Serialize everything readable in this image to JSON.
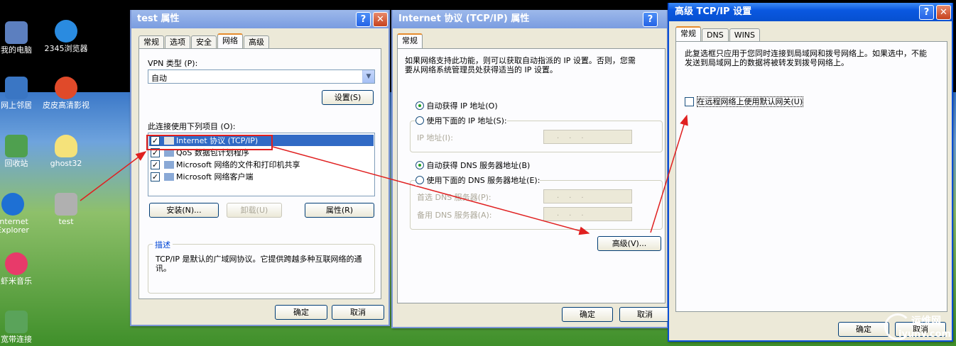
{
  "desktop": {
    "icons": [
      {
        "label": "我的电脑",
        "name": "my-computer-icon",
        "color": "#5c7fbf"
      },
      {
        "label": "2345浏览器",
        "name": "browser-2345-icon",
        "color": "#2a8be0"
      },
      {
        "label": "网上邻居",
        "name": "network-places-icon",
        "color": "#3a76c4"
      },
      {
        "label": "皮皮高清影视",
        "name": "pipi-video-icon",
        "color": "#e04a2a"
      },
      {
        "label": "回收站",
        "name": "recycle-bin-icon",
        "color": "#4fa04f"
      },
      {
        "label": "ghost32",
        "name": "ghost32-icon",
        "color": "#f5e27a"
      },
      {
        "label": "Internet Explorer",
        "name": "internet-explorer-icon",
        "color": "#1e70d4"
      },
      {
        "label": "test",
        "name": "test-connection-icon",
        "color": "#b0b0b0"
      },
      {
        "label": "虾米音乐",
        "name": "xiami-music-icon",
        "color": "#e83a6a"
      },
      {
        "label": "宽带连接",
        "name": "broadband-connection-icon",
        "color": "#5aa35a"
      }
    ]
  },
  "win1": {
    "title": "test 属性",
    "help": "?",
    "close": "✕",
    "tabs": [
      "常规",
      "选项",
      "安全",
      "网络",
      "高级"
    ],
    "vpn_label": "VPN 类型 (P):",
    "vpn_value": "自动",
    "settings_button": "设置(S)",
    "items_label": "此连接使用下列项目 (O):",
    "items": [
      {
        "label": "Internet 协议 (TCP/IP)",
        "checked": true,
        "selected": true,
        "icon": "network-protocol-icon"
      },
      {
        "label": "QoS 数据包计划程序",
        "checked": true,
        "selected": false,
        "icon": "qos-icon"
      },
      {
        "label": "Microsoft 网络的文件和打印机共享",
        "checked": true,
        "selected": false,
        "icon": "file-share-icon"
      },
      {
        "label": "Microsoft 网络客户端",
        "checked": true,
        "selected": false,
        "icon": "network-client-icon"
      }
    ],
    "install_button": "安装(N)...",
    "uninstall_button": "卸载(U)",
    "properties_button": "属性(R)",
    "description_title": "描述",
    "description": "TCP/IP 是默认的广域网协议。它提供跨越多种互联网络的通讯。",
    "ok_button": "确定",
    "cancel_button": "取消"
  },
  "win2": {
    "title": "Internet 协议 (TCP/IP) 属性",
    "help": "?",
    "close": "✕",
    "tab": "常规",
    "intro": "如果网络支持此功能，则可以获取自动指派的 IP 设置。否则，您需要从网络系统管理员处获得适当的 IP 设置。",
    "auto_ip": "自动获得 IP 地址(O)",
    "manual_ip": "使用下面的 IP 地址(S):",
    "ip_label": "IP 地址(I):",
    "auto_dns": "自动获得 DNS 服务器地址(B)",
    "manual_dns": "使用下面的 DNS 服务器地址(E):",
    "preferred_dns": "首选 DNS 服务器(P):",
    "alternate_dns": "备用 DNS 服务器(A):",
    "ip_placeholder": "...",
    "advanced_button": "高级(V)...",
    "ok_button": "确定",
    "cancel_button": "取消"
  },
  "win3": {
    "title": "高级 TCP/IP 设置",
    "help": "?",
    "close": "✕",
    "tabs": [
      "常规",
      "DNS",
      "WINS"
    ],
    "description": "此复选框只应用于您同时连接到局域网和拨号网络上。如果选中，不能发送到局域网上的数据将被转发到拨号网络上。",
    "gateway_checkbox": "在远程网络上使用默认网关(U)",
    "gateway_checked": false,
    "ok_button": "确定",
    "cancel_button": "取消"
  },
  "watermark": {
    "cn": "运维网",
    "url": "iyunv.com"
  },
  "colors": {
    "titlebar": "#0a58e0",
    "highlight": "#316ac5",
    "arrow": "#e02020"
  }
}
